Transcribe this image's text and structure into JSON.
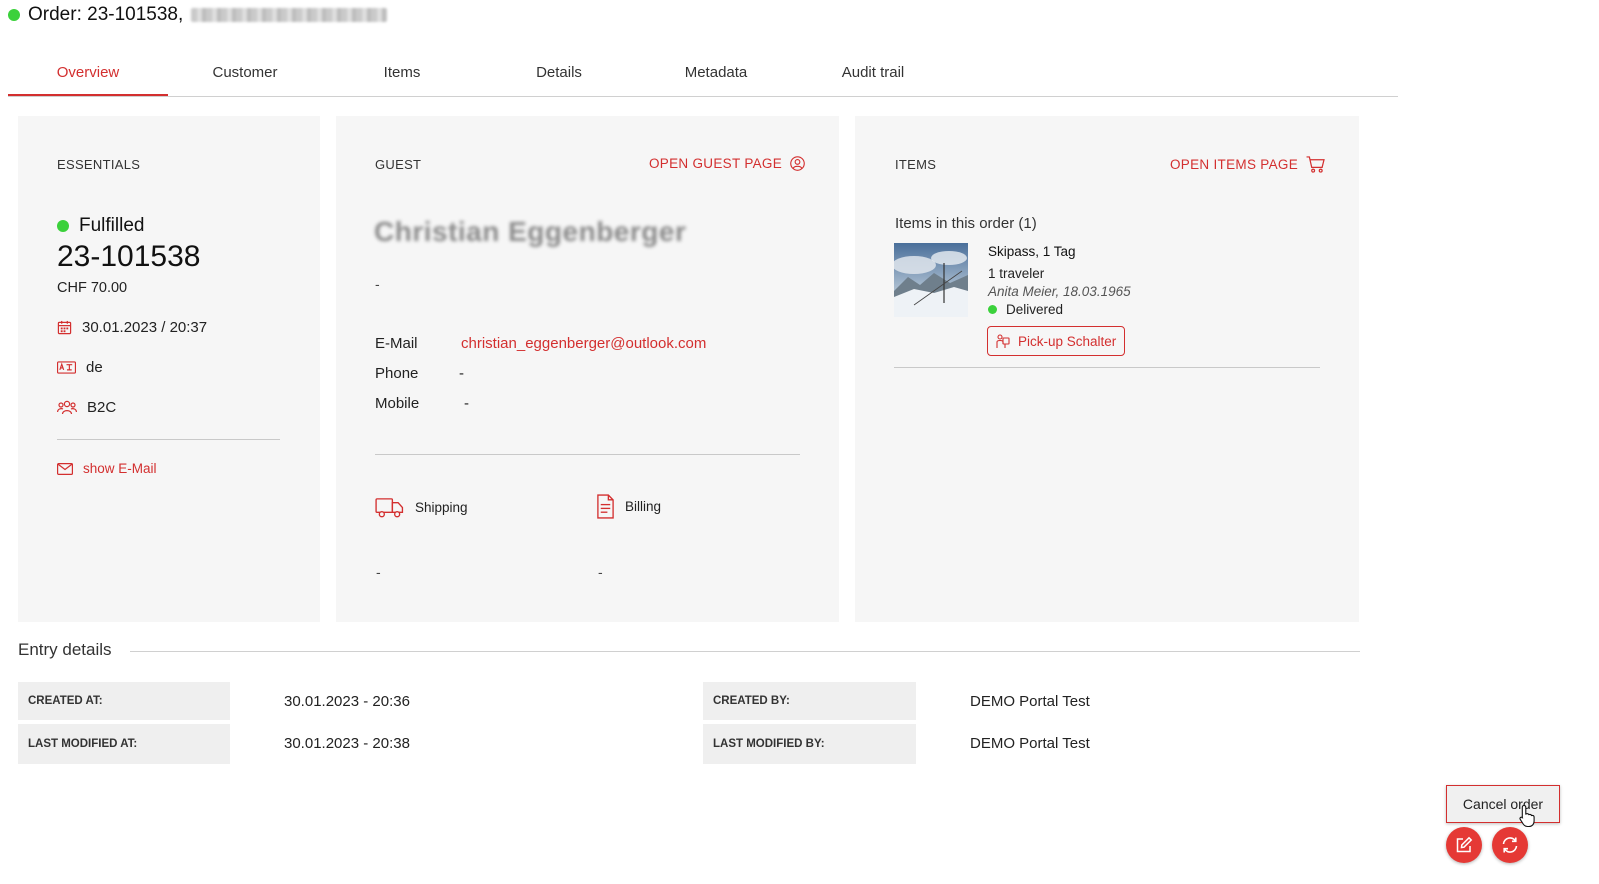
{
  "header": {
    "status_color": "#3bd13b",
    "title": "Order: 23-101538,"
  },
  "tabs": [
    {
      "label": "Overview",
      "active": true
    },
    {
      "label": "Customer"
    },
    {
      "label": "Items"
    },
    {
      "label": "Details"
    },
    {
      "label": "Metadata"
    },
    {
      "label": "Audit trail"
    }
  ],
  "essentials": {
    "label": "ESSENTIALS",
    "status": "Fulfilled",
    "order_number": "23-101538",
    "amount": "CHF 70.00",
    "date": "30.01.2023 / 20:37",
    "language": "de",
    "segment": "B2C",
    "show_email": "show E-Mail"
  },
  "guest": {
    "label": "GUEST",
    "open_link": "OPEN GUEST PAGE",
    "name": "Christian Eggenberger",
    "subline": "-",
    "email_label": "E-Mail",
    "email_value": "christian_eggenberger@outlook.com",
    "phone_label": "Phone",
    "phone_value": "-",
    "mobile_label": "Mobile",
    "mobile_value": "-",
    "shipping_label": "Shipping",
    "shipping_value": "-",
    "billing_label": "Billing",
    "billing_value": "-"
  },
  "items": {
    "label": "ITEMS",
    "open_link": "OPEN ITEMS PAGE",
    "count_text": "Items in this order (1)",
    "list": [
      {
        "name": "Skipass, 1 Tag",
        "travelers": "1 traveler",
        "traveler_detail": "Anita Meier, 18.03.1965",
        "status": "Delivered",
        "pickup_button": "Pick-up Schalter"
      }
    ]
  },
  "entry_details": {
    "title": "Entry details",
    "created_at_label": "CREATED AT:",
    "created_at_value": "30.01.2023 - 20:36",
    "last_modified_at_label": "LAST MODIFIED AT:",
    "last_modified_at_value": "30.01.2023 - 20:38",
    "created_by_label": "CREATED BY:",
    "created_by_value": "DEMO Portal Test",
    "last_modified_by_label": "LAST MODIFIED BY:",
    "last_modified_by_value": "DEMO Portal Test"
  },
  "actions": {
    "cancel_order": "Cancel order",
    "fab_color": "#e53935"
  }
}
